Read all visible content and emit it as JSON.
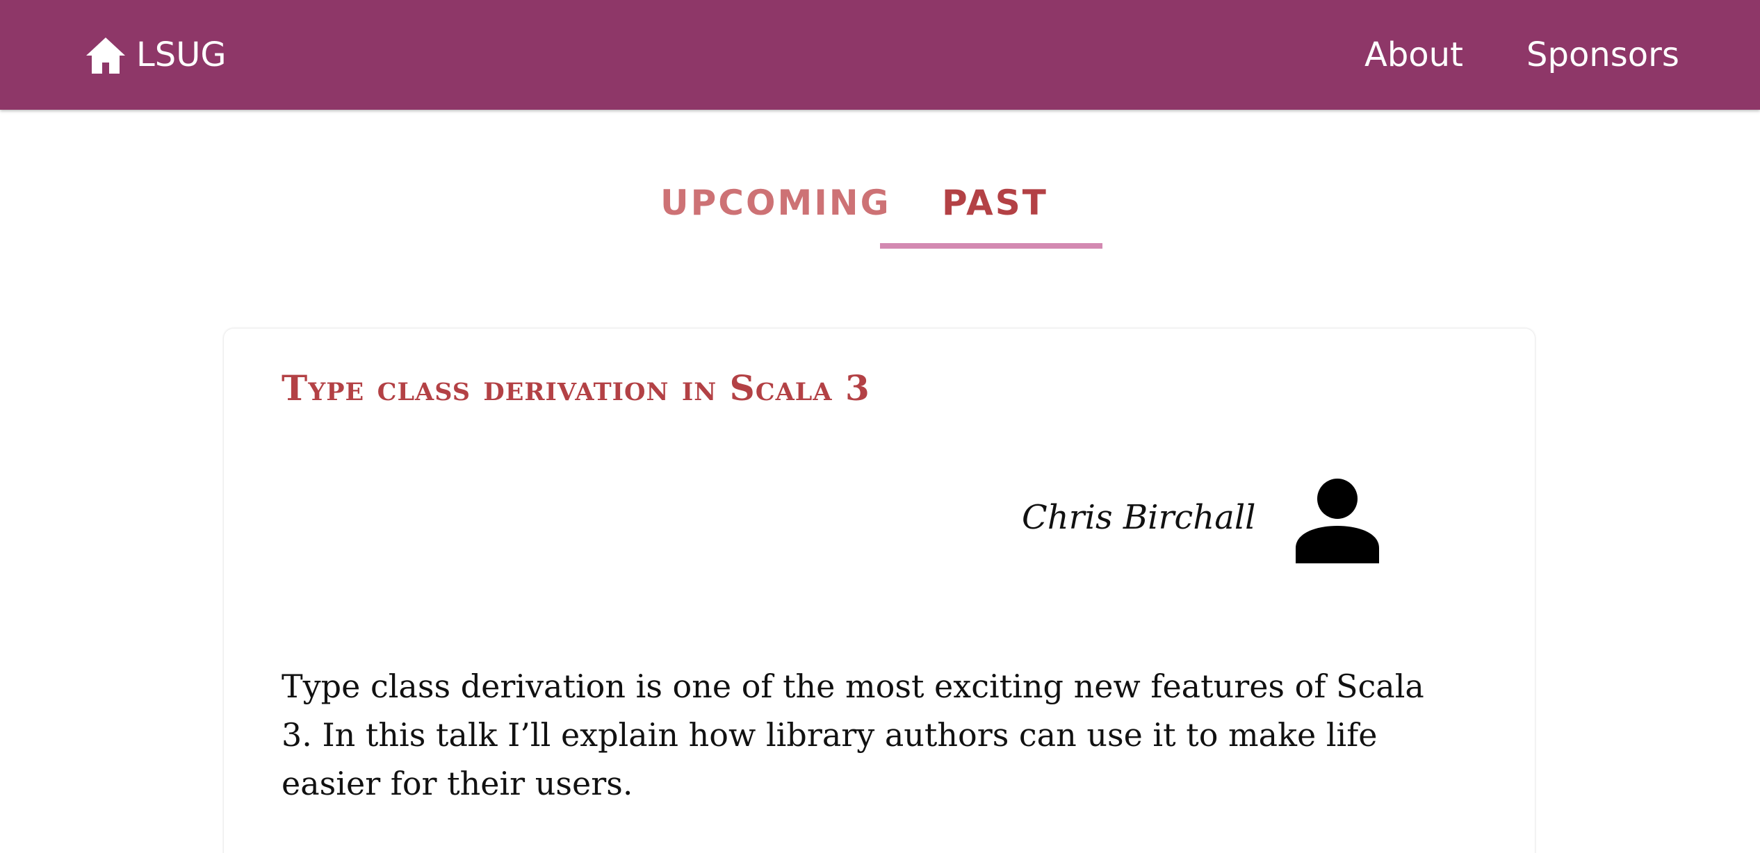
{
  "header": {
    "brand": {
      "icon": "home-icon",
      "label": "LSUG"
    },
    "nav": {
      "about_label": "About",
      "sponsors_label": "Sponsors"
    },
    "colors": {
      "bar_background": "#8e3768",
      "text": "#ffffff"
    }
  },
  "tabs": {
    "items": [
      {
        "label": "UPCOMING",
        "selected": false
      },
      {
        "label": "PAST",
        "selected": true
      }
    ],
    "colors": {
      "inactive": "#cd7275",
      "active": "#b34145",
      "indicator": "#d389b1"
    }
  },
  "event": {
    "title": "Type class derivation in Scala 3",
    "speaker": {
      "name": "Chris Birchall",
      "avatar_icon": "person-icon"
    },
    "abstract": "Type class derivation is one of the most exciting new features of Scala 3. In this talk I’ll explain how library authors can use it to make life easier for their users.",
    "colors": {
      "title": "#b34145"
    }
  }
}
